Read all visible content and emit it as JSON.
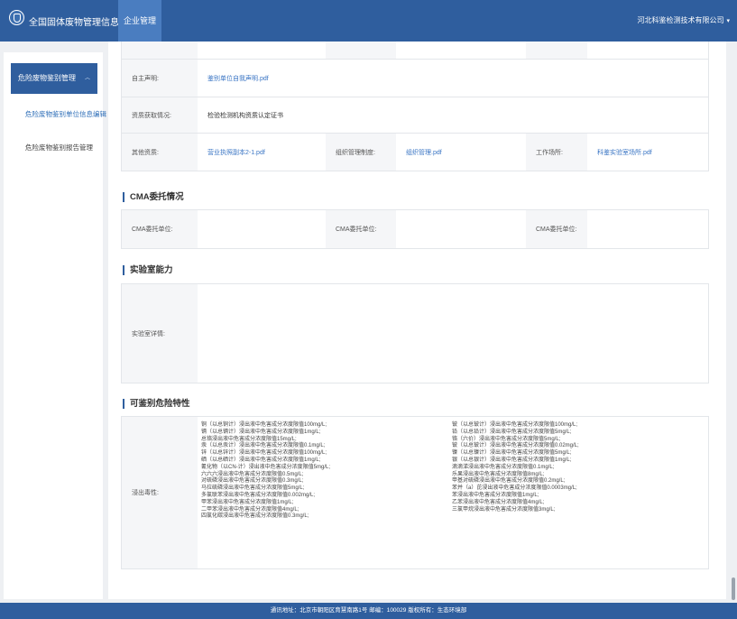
{
  "header": {
    "system_title": "全国固体废物管理信息系统",
    "tab": "企业管理",
    "company": "河北科鉴检测技术有限公司"
  },
  "sidebar": {
    "group": "危险废物鉴别管理",
    "sub_item": "危险废物鉴别单位信息编辑",
    "item": "危险废物鉴别报告管理"
  },
  "qualifications": {
    "self_declaration_label": "自主声明:",
    "self_declaration_file": "鉴别单位自我声明.pdf",
    "obtained_label": "资质获取情况:",
    "obtained_value": "检验检测机构资质认定证书",
    "other_label": "其他资质:",
    "other_file": "营业执照副本2-1.pdf",
    "org_label": "组织管理制度:",
    "org_file": "组织管理.pdf",
    "workplace_label": "工作场所:",
    "workplace_file": "科鉴实验室场所.pdf"
  },
  "cma": {
    "section_title": "CMA委托情况",
    "label": "CMA委托单位:"
  },
  "lab": {
    "section_title": "实验室能力",
    "label": "实验室详情:"
  },
  "hazard": {
    "section_title": "可鉴别危险特性",
    "label": "浸出毒性:",
    "left_items": [
      "铜（以总铜计）浸出液中危害成分浓度限值100mg/L;",
      "镉（以总镉计）浸出液中危害成分浓度限值1mg/L;",
      "总铬浸出液中危害成分浓度限值15mg/L;",
      "汞（以总汞计）浸出液中危害成分浓度限值0.1mg/L;",
      "锌（以总锌计）浸出液中危害成分浓度限值100mg/L;",
      "硒（以总硒计）浸出液中危害成分浓度限值1mg/L;",
      "氰化物（以CN-计）浸出液中危害成分浓度限值5mg/L;",
      "六六六浸出液中危害成分浓度限值0.5mg/L;",
      "对硫磷浸出液中危害成分浓度限值0.3mg/L;",
      "马拉硫磷浸出液中危害成分浓度限值5mg/L;",
      "多氯联苯浸出液中危害成分浓度限值0.002mg/L;",
      "甲苯浸出液中危害成分浓度限值1mg/L;",
      "二甲苯浸出液中危害成分浓度限值4mg/L;",
      "四氯化碳浸出液中危害成分浓度限值0.3mg/L;"
    ],
    "right_items": [
      "铍（以总铍计）浸出液中危害成分浓度限值100mg/L;",
      "铅（以总铅计）浸出液中危害成分浓度限值5mg/L;",
      "铬（六价）浸出液中危害成分浓度限值5mg/L;",
      "铍（以总铍计）浸出液中危害成分浓度限值0.02mg/L;",
      "镍（以总镍计）浸出液中危害成分浓度限值5mg/L;",
      "银（以总银计）浸出液中危害成分浓度限值1mg/L;",
      "滴滴涕浸出液中危害成分浓度限值0.1mg/L;",
      "乐果浸出液中危害成分浓度限值8mg/L;",
      "甲基对硫磷浸出液中危害成分浓度限值0.2mg/L;",
      "苯并（a）芘浸出液中危害成分浓度限值0.0003mg/L;",
      "苯浸出液中危害成分浓度限值1mg/L;",
      "乙苯浸出液中危害成分浓度限值4mg/L;",
      "三氯甲烷浸出液中危害成分浓度限值3mg/L;"
    ]
  },
  "footer": {
    "text": "通讯地址：北京市朝阳区育慧南路1号    邮编：100029    版权所有：生态环境部"
  }
}
